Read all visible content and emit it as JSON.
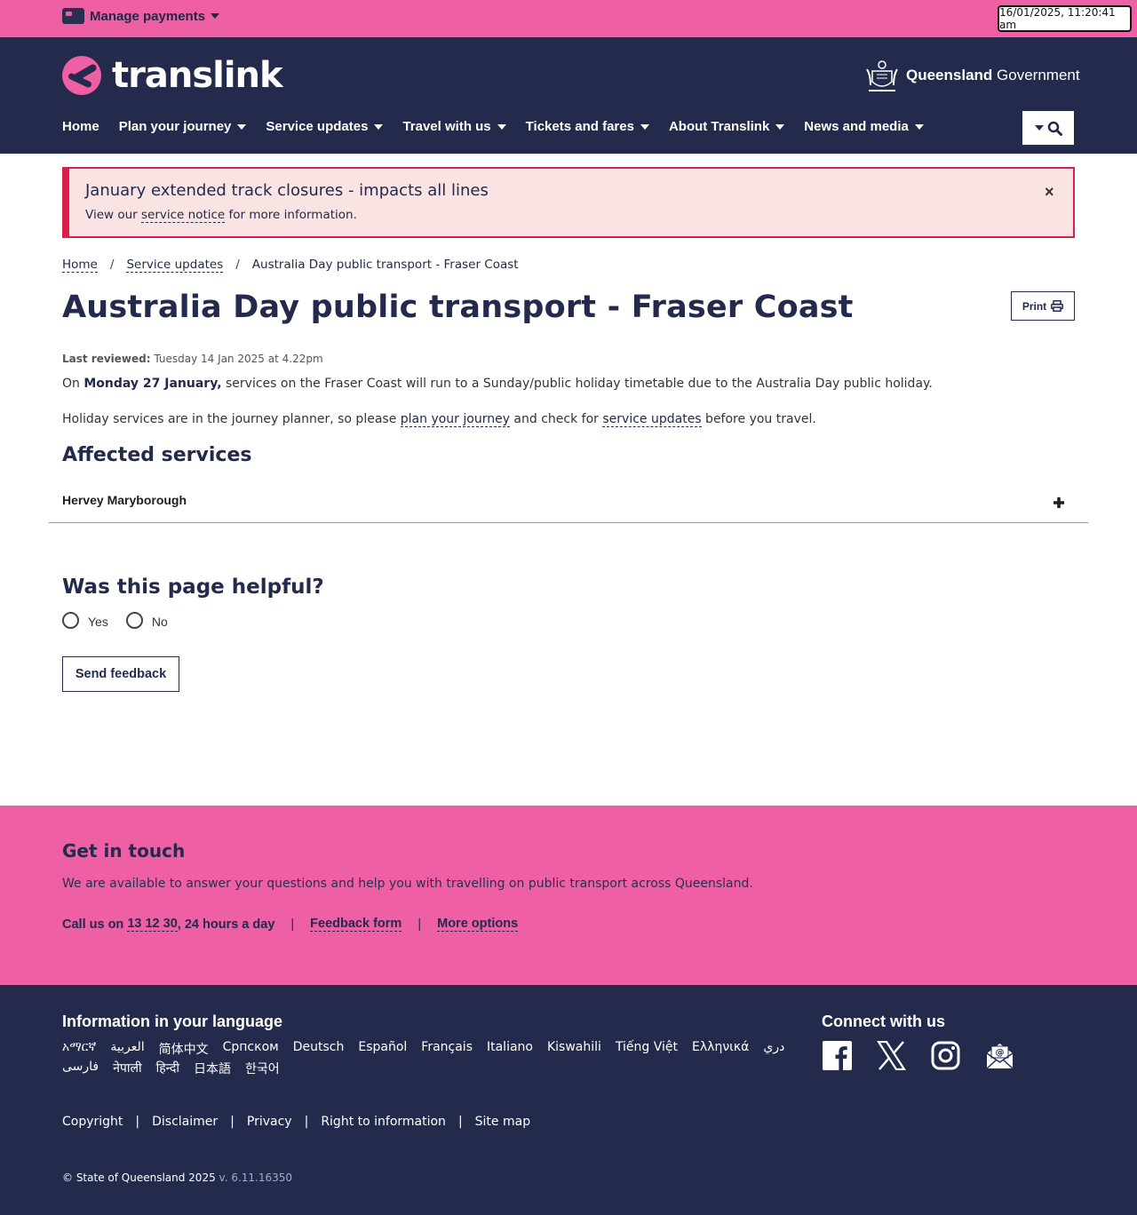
{
  "topbar": {
    "manage_label": "Manage payments",
    "clock": "16/01/2025, 11:20:41 am"
  },
  "header": {
    "logo_text": "translink",
    "gov_bold": "Queensland",
    "gov_rest": " Government",
    "nav": [
      {
        "label": "Home",
        "dropdown": false
      },
      {
        "label": "Plan your journey",
        "dropdown": true
      },
      {
        "label": "Service updates",
        "dropdown": true
      },
      {
        "label": "Travel with us",
        "dropdown": true
      },
      {
        "label": "Tickets and fares",
        "dropdown": true
      },
      {
        "label": "About Translink",
        "dropdown": true
      },
      {
        "label": "News and media",
        "dropdown": true
      }
    ]
  },
  "alert": {
    "title": "January extended track closures - impacts all lines",
    "body_prefix": "View our ",
    "body_link": "service notice",
    "body_suffix": " for more information.",
    "close": "×"
  },
  "breadcrumb": {
    "items": [
      "Home",
      "Service updates",
      "Australia Day public transport - Fraser Coast"
    ],
    "separator": "/"
  },
  "page": {
    "title": "Australia Day public transport - Fraser Coast",
    "print_label": "Print",
    "reviewed_label": "Last reviewed:",
    "reviewed_value": " Tuesday 14 Jan 2025 at 4.22pm",
    "para1_prefix": "On ",
    "para1_bold": "Monday 27 January,",
    "para1_suffix": " services on the Fraser Coast will run to a Sunday/public holiday timetable due to the Australia Day public holiday.",
    "para2_prefix": "Holiday services are in the journey planner, so please ",
    "para2_link1": "plan your journey",
    "para2_mid": " and check for ",
    "para2_link2": "service updates",
    "para2_suffix": " before you travel.",
    "affected_heading": "Affected services",
    "accordion_label": "Hervey Maryborough",
    "accordion_toggle": "+"
  },
  "feedback": {
    "heading": "Was this page helpful?",
    "yes": "Yes",
    "no": "No",
    "send": "Send feedback"
  },
  "touch": {
    "heading": "Get in touch",
    "text": "We are available to answer your questions and help you with travelling on public transport across Queensland.",
    "call_prefix": "Call us on ",
    "call_number": "13 12 30",
    "call_suffix": ", 24 hours a day",
    "feedback_link": "Feedback form",
    "more_link": "More options",
    "pipe": "|"
  },
  "footer": {
    "lang_heading": "Information in your language",
    "languages": [
      "አማርኛ",
      "العربية",
      "简体中文",
      "Српском",
      "Deutsch",
      "Español",
      "Français",
      "Italiano",
      "Kiswahili",
      "Tiếng Việt",
      "Ελληνικά",
      "دري",
      "فارسی",
      "नेपाली",
      "हिन्दी",
      "日本語",
      "한국어"
    ],
    "connect_heading": "Connect with us",
    "links": [
      "Copyright",
      "Disclaimer",
      "Privacy",
      "Right to information",
      "Site map"
    ],
    "pipe": "|",
    "copyright": "© State of Queensland 2025",
    "version": " v. 6.11.16350"
  },
  "colors": {
    "pink": "#ee5fa3",
    "navy": "#232a4c",
    "alert_red": "#d8204b",
    "alert_bg": "#f9e3e3"
  }
}
